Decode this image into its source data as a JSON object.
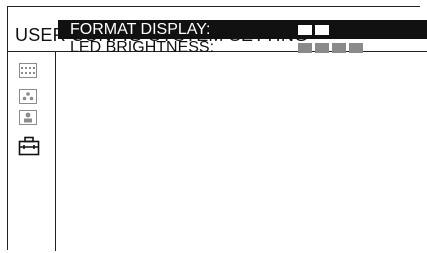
{
  "header": {
    "title": "USER CONFIG-SYSTEM SETTING"
  },
  "sidebar": {
    "tabs": [
      {
        "icon": "grid-dots-icon",
        "selected": false
      },
      {
        "icon": "dots-cluster-icon",
        "selected": false
      },
      {
        "icon": "person-icon",
        "selected": false
      },
      {
        "icon": "toolbox-icon",
        "selected": true
      }
    ]
  },
  "menu": {
    "items": [
      {
        "label": "FORMAT DISPLAY:",
        "level": 2,
        "max_level": 2,
        "selected": true
      },
      {
        "label": "LED BRIGHTNESS:",
        "level": 4,
        "max_level": 4,
        "selected": false
      }
    ]
  },
  "colors": {
    "highlight_bg": "#111111",
    "highlight_fg": "#ffffff",
    "meter_dim": "#8a8a8a"
  }
}
